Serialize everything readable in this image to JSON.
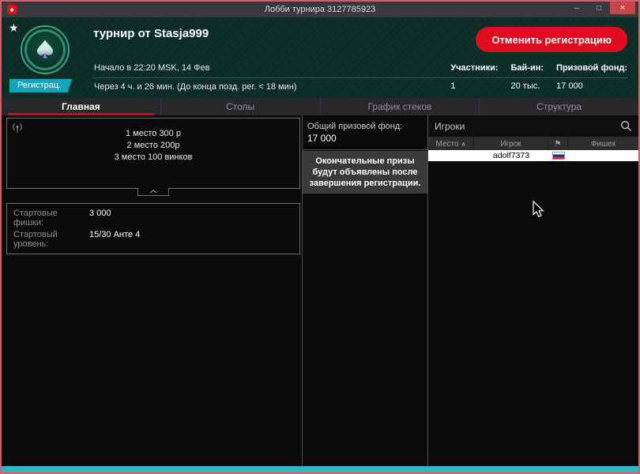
{
  "window": {
    "title": "Лобби турнира 3127785923",
    "app_icon": "♠",
    "star_icon": "★",
    "minimize_icon": "–",
    "maximize_icon": "□",
    "close_icon": "×"
  },
  "header": {
    "badge": "Регистрац.",
    "tournament_name": "турнир от Stasja999",
    "start_line": "Начало в 22:20 MSK, 14 Фев",
    "time_line": "Через 4 ч. и 26 мин. (До конца позд. рег. < 18 мин)",
    "cancel_button": "Отменить регистрацию",
    "stats": [
      {
        "label": "Участники:",
        "value": "1"
      },
      {
        "label": "Бай-ин:",
        "value": "20 тыс."
      },
      {
        "label": "Призовой фонд:",
        "value": "17 000"
      }
    ]
  },
  "tabs": [
    {
      "label": "Главная"
    },
    {
      "label": "Столы"
    },
    {
      "label": "График стеков"
    },
    {
      "label": "Структура"
    }
  ],
  "prizes": {
    "lines": [
      "1 место 300 р",
      "2 место 200р",
      "3 место 100 винков"
    ]
  },
  "chips": {
    "rows": [
      {
        "label": "Стартовые фишки:",
        "value": "3 000"
      },
      {
        "label": "Стартовый уровень:",
        "value": "15/30 Анте 4"
      }
    ]
  },
  "prize_pool": {
    "label": "Общий призовой фонд:",
    "value": "17 000",
    "note": "Окончательные призы будут объявлены после завершения регистрации."
  },
  "players": {
    "search_placeholder": "Игроки",
    "sort_icon": "∧",
    "flag_header_icon": "⚑",
    "columns": {
      "place": "Место",
      "player": "Игрок",
      "chips": "Фишек"
    },
    "rows": [
      {
        "place": "",
        "player": "adolf7373",
        "flag": "ru",
        "chips": ""
      }
    ]
  },
  "colors": {
    "window_border": "#d95b72",
    "accent_red": "#e10c1d",
    "badge_teal": "#14a5b8",
    "status_teal": "#2cb5c3",
    "header_green": "#0b2d25",
    "active_tab_underline": "#d8001e"
  }
}
